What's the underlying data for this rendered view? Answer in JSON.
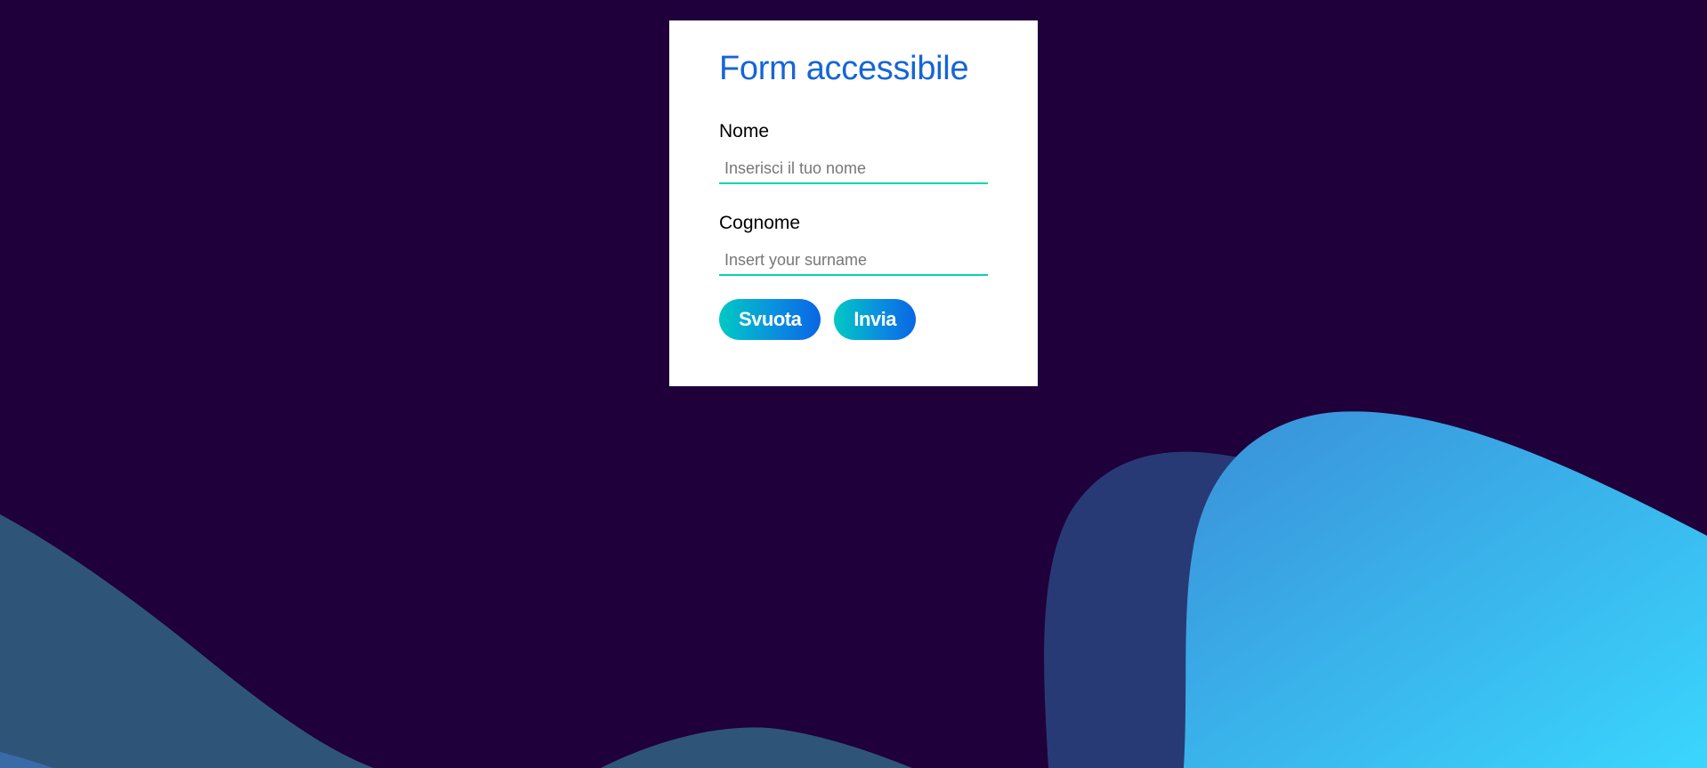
{
  "form": {
    "title": "Form accessibile",
    "fields": [
      {
        "label": "Nome",
        "placeholder": "Inserisci il tuo nome",
        "value": ""
      },
      {
        "label": "Cognome",
        "placeholder": "Insert your surname",
        "value": ""
      }
    ],
    "buttons": {
      "reset_label": "Svuota",
      "submit_label": "Invia"
    }
  },
  "colors": {
    "background": "#1f003b",
    "title": "#1565d8",
    "input_underline": "#00d4b4",
    "button_gradient_start": "#00c9c4",
    "button_gradient_end": "#0a66e4",
    "wave_dark": "#2e5577",
    "wave_mid": "#283a75",
    "wave_light": "#3ad6fd"
  }
}
